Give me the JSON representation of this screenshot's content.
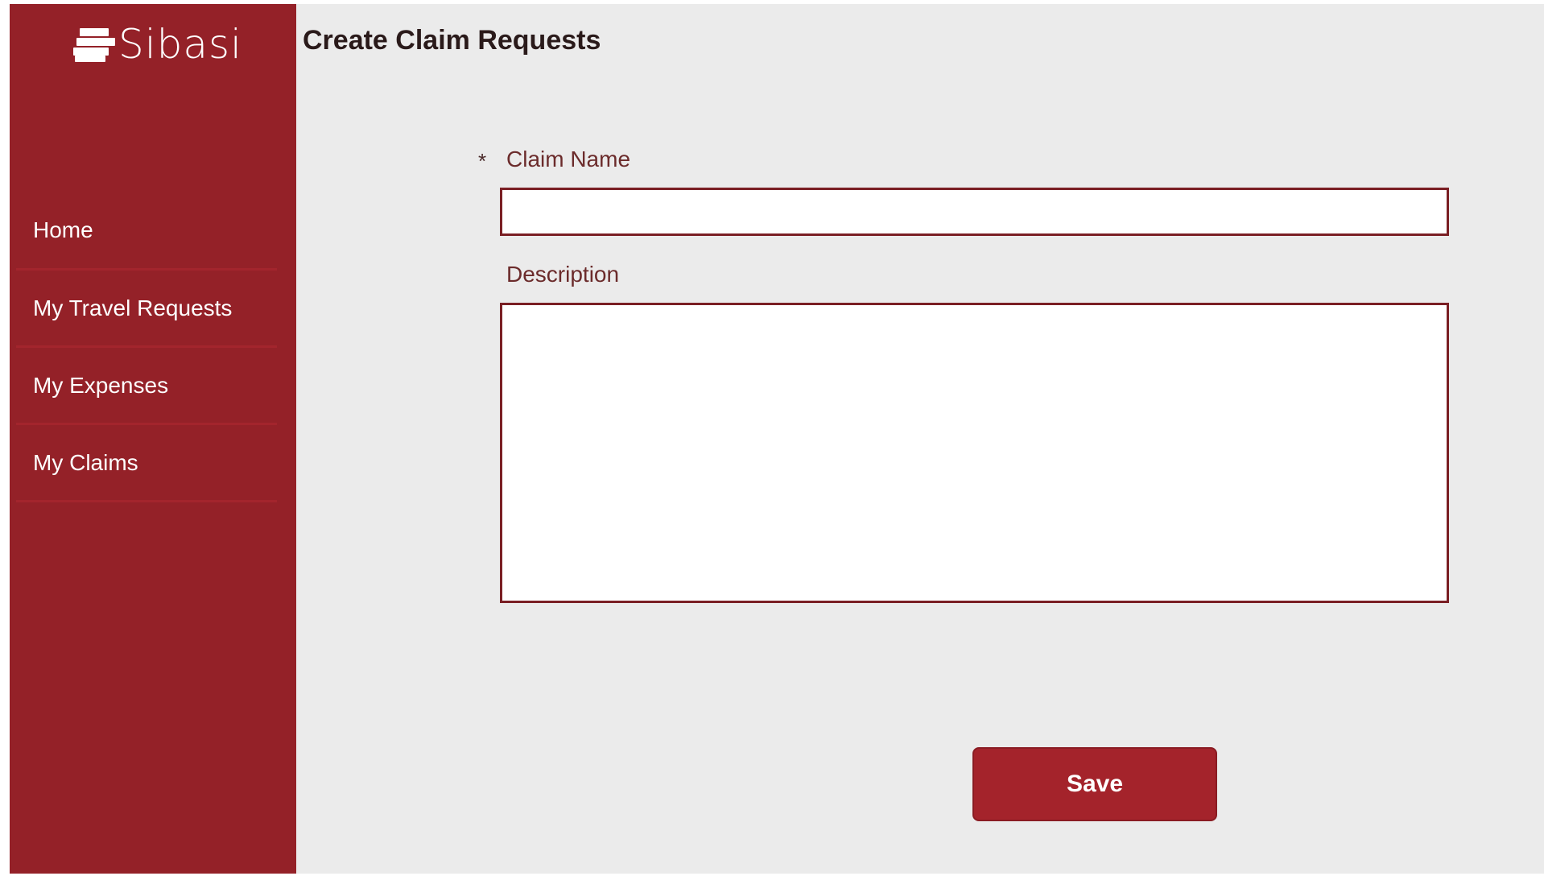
{
  "app": {
    "logo_text": "Sibasi",
    "brand_color": "#942128",
    "logo_icon": "stacked-bars-icon"
  },
  "sidebar": {
    "items": [
      {
        "label": "Home"
      },
      {
        "label": "My Travel Requests"
      },
      {
        "label": "My Expenses"
      },
      {
        "label": "My Claims"
      }
    ]
  },
  "page": {
    "title": "Create Claim Requests"
  },
  "form": {
    "required_marker": "*",
    "claim_name": {
      "label": "Claim Name",
      "value": "",
      "placeholder": ""
    },
    "description": {
      "label": "Description",
      "value": "",
      "placeholder": ""
    },
    "save_label": "Save"
  }
}
